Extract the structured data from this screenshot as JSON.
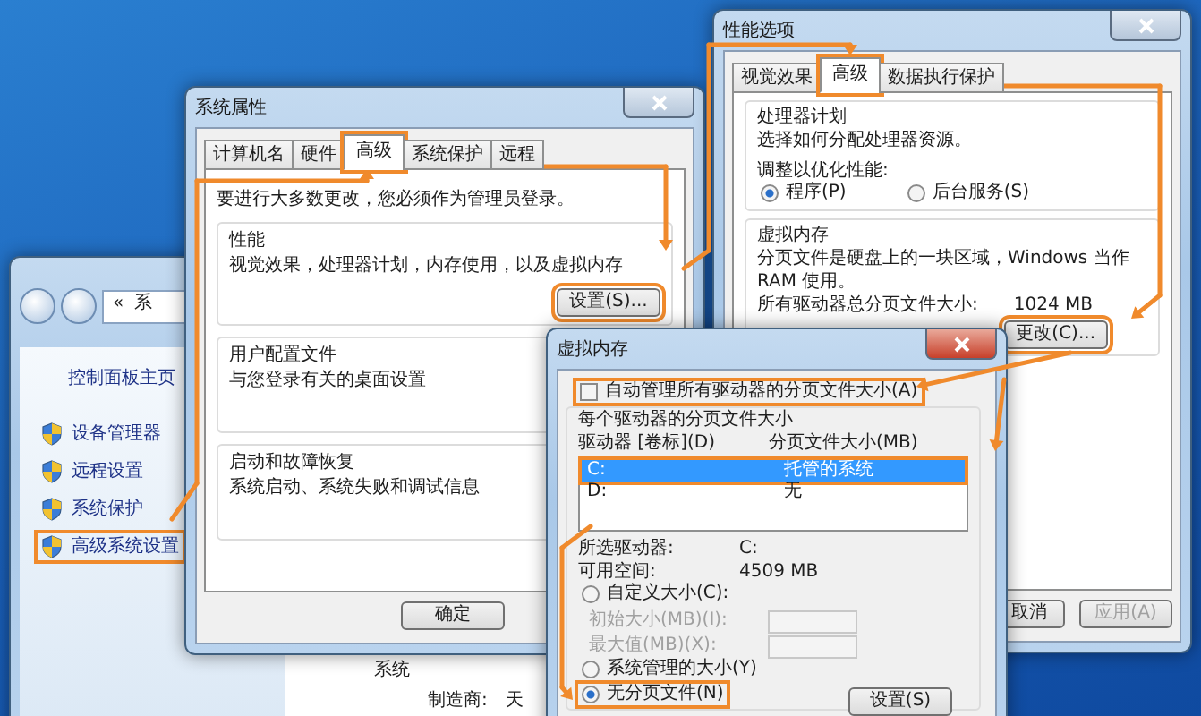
{
  "control_panel": {
    "address_prefix": "«",
    "address": "系",
    "home_link": "控制面板主页",
    "links": [
      {
        "label": "设备管理器",
        "highlighted": false
      },
      {
        "label": "远程设置",
        "highlighted": false
      },
      {
        "label": "系统保护",
        "highlighted": false
      },
      {
        "label": "高级系统设置",
        "highlighted": true
      }
    ],
    "section": "系统",
    "field_label": "制造商:",
    "field_value": "天"
  },
  "system_properties": {
    "title": "系统属性",
    "tabs": [
      {
        "label": "计算机名",
        "selected": false,
        "highlighted": false
      },
      {
        "label": "硬件",
        "selected": false,
        "highlighted": false
      },
      {
        "label": "高级",
        "selected": true,
        "highlighted": true
      },
      {
        "label": "系统保护",
        "selected": false,
        "highlighted": false
      },
      {
        "label": "远程",
        "selected": false,
        "highlighted": false
      }
    ],
    "notice": "要进行大多数更改，您必须作为管理员登录。",
    "groups": [
      {
        "title": "性能",
        "description": "视觉效果，处理器计划，内存使用，以及虚拟内存",
        "button": "设置(S)...",
        "button_highlighted": true
      },
      {
        "title": "用户配置文件",
        "description": "与您登录有关的桌面设置"
      },
      {
        "title": "启动和故障恢复",
        "description": "系统启动、系统失败和调试信息"
      }
    ],
    "buttons": [
      "确定"
    ]
  },
  "performance_options": {
    "title": "性能选项",
    "tabs": [
      {
        "label": "视觉效果",
        "selected": false,
        "highlighted": false
      },
      {
        "label": "高级",
        "selected": true,
        "highlighted": true
      },
      {
        "label": "数据执行保护",
        "selected": false,
        "highlighted": false
      }
    ],
    "processor": {
      "title": "处理器计划",
      "description": "选择如何分配处理器资源。",
      "prompt": "调整以优化性能:",
      "options": [
        {
          "label": "程序(P)",
          "selected": true
        },
        {
          "label": "后台服务(S)",
          "selected": false
        }
      ]
    },
    "virtual_memory": {
      "title": "虚拟内存",
      "description": "分页文件是硬盘上的一块区域，Windows 当作 RAM 使用。",
      "total_label": "所有驱动器总分页文件大小:",
      "total_value": "1024 MB",
      "button": "更改(C)...",
      "button_highlighted": true
    },
    "buttons": [
      {
        "label": "取消",
        "disabled": false
      },
      {
        "label": "应用(A)",
        "disabled": true
      }
    ]
  },
  "virtual_memory": {
    "title": "虚拟内存",
    "auto_manage": {
      "label": "自动管理所有驱动器的分页文件大小(A)",
      "checked": false,
      "highlighted": true
    },
    "group_title": "每个驱动器的分页文件大小",
    "columns": [
      "驱动器 [卷标](D)",
      "分页文件大小(MB)"
    ],
    "drives_highlighted": true,
    "drives": [
      {
        "drive": "C:",
        "size": "托管的系统",
        "selected": true
      },
      {
        "drive": "D:",
        "size": "无",
        "selected": false
      }
    ],
    "selected_label": "所选驱动器:",
    "selected_value": "C:",
    "free_label": "可用空间:",
    "free_value": "4509 MB",
    "options": [
      {
        "kind": "radio",
        "label": "自定义大小(C):",
        "selected": false,
        "highlighted": false
      },
      {
        "kind": "field",
        "label": "初始大小(MB)(I):",
        "disabled": true
      },
      {
        "kind": "field",
        "label": "最大值(MB)(X):",
        "disabled": true
      },
      {
        "kind": "radio",
        "label": "系统管理的大小(Y)",
        "selected": false,
        "highlighted": false
      },
      {
        "kind": "radio",
        "label": "无分页文件(N)",
        "selected": true,
        "highlighted": true
      }
    ],
    "button": "设置(S)"
  }
}
